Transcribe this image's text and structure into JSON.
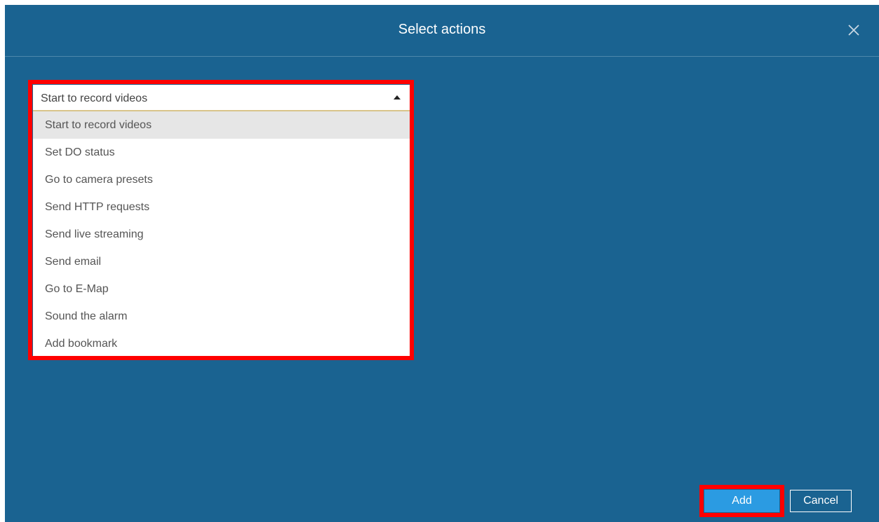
{
  "dialog": {
    "title": "Select actions"
  },
  "dropdown": {
    "selected_value": "Start to record videos",
    "options": [
      "Start to record videos",
      "Set DO status",
      "Go to camera presets",
      "Send HTTP requests",
      "Send live streaming",
      "Send email",
      "Go to E-Map",
      "Sound the alarm",
      "Add bookmark"
    ],
    "highlighted_index": 0
  },
  "footer": {
    "add_label": "Add",
    "cancel_label": "Cancel"
  },
  "icons": {
    "close": "close-icon",
    "caret": "caret-up-icon"
  },
  "colors": {
    "background": "#1a6391",
    "highlight": "#ff0000",
    "add_button": "#2b9be2",
    "selected_option": "#e6e6e6"
  }
}
